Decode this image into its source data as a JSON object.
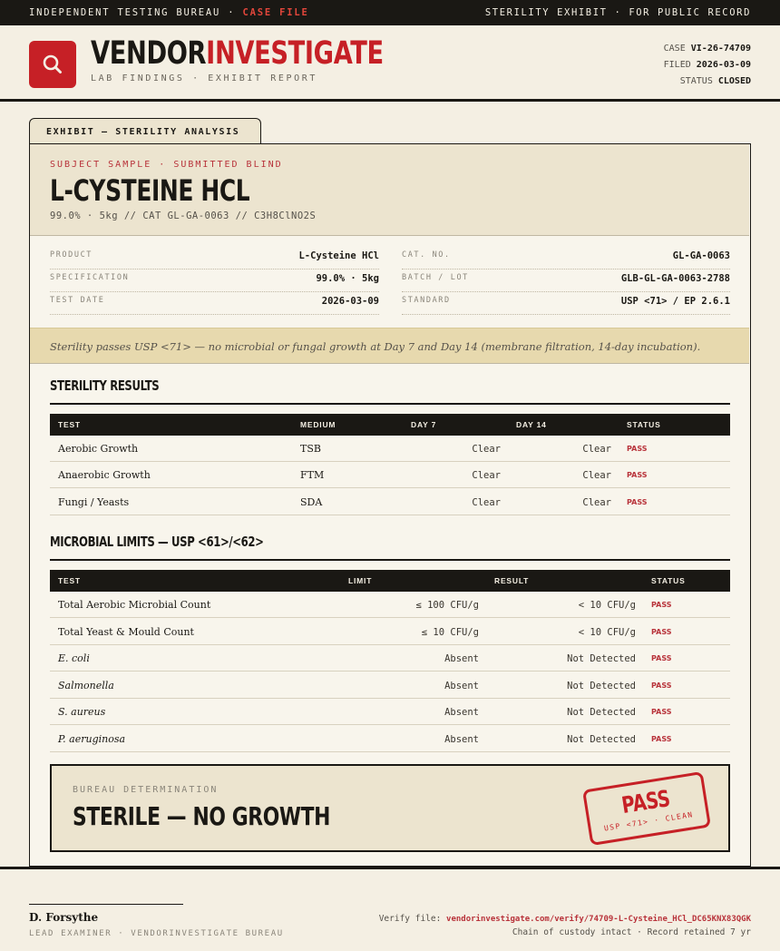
{
  "topbar": {
    "left_prefix": "INDEPENDENT TESTING BUREAU · ",
    "left_highlight": "CASE FILE",
    "right": "STERILITY EXHIBIT · FOR PUBLIC RECORD"
  },
  "header": {
    "logo_icon": "magnifier-icon",
    "brand_part1": "VENDOR",
    "brand_part2": "INVESTIGATE",
    "subtitle": "LAB FINDINGS · EXHIBIT REPORT",
    "case_label": "CASE",
    "case_value": "VI-26-74709",
    "filed_label": "FILED",
    "filed_value": "2026-03-09",
    "status_label": "STATUS",
    "status_value": "CLOSED"
  },
  "tab": {
    "label": "EXHIBIT — STERILITY ANALYSIS"
  },
  "subject": {
    "kicker": "SUBJECT SAMPLE · SUBMITTED BLIND",
    "title": "L-CYSTEINE HCL",
    "details": "99.0% · 5kg  //  CAT GL-GA-0063  //  C3H8ClNO2S"
  },
  "info": {
    "left": [
      {
        "label": "PRODUCT",
        "value": "L-Cysteine HCl"
      },
      {
        "label": "SPECIFICATION",
        "value": "99.0% · 5kg"
      },
      {
        "label": "TEST DATE",
        "value": "2026-03-09"
      }
    ],
    "right": [
      {
        "label": "CAT. NO.",
        "value": "GL-GA-0063"
      },
      {
        "label": "BATCH / LOT",
        "value": "GLB-GL-GA-0063-2788"
      },
      {
        "label": "STANDARD",
        "value": "USP <71> / EP 2.6.1"
      }
    ]
  },
  "summary_note": "Sterility passes USP <71> — no microbial or fungal growth at Day 7 and Day 14 (membrane filtration, 14-day incubation).",
  "sterility": {
    "title": "STERILITY RESULTS",
    "headers": [
      "TEST",
      "MEDIUM",
      "DAY 7",
      "DAY 14",
      "STATUS"
    ],
    "rows": [
      {
        "test": "Aerobic Growth",
        "medium": "TSB",
        "day7": "Clear",
        "day14": "Clear",
        "status": "PASS"
      },
      {
        "test": "Anaerobic Growth",
        "medium": "FTM",
        "day7": "Clear",
        "day14": "Clear",
        "status": "PASS"
      },
      {
        "test": "Fungi / Yeasts",
        "medium": "SDA",
        "day7": "Clear",
        "day14": "Clear",
        "status": "PASS"
      }
    ]
  },
  "microbial": {
    "title": "MICROBIAL LIMITS — USP <61>/<62>",
    "headers": [
      "TEST",
      "LIMIT",
      "RESULT",
      "STATUS"
    ],
    "rows": [
      {
        "test": "Total Aerobic Microbial Count",
        "limit": "≤ 100 CFU/g",
        "result": "< 10 CFU/g",
        "status": "PASS"
      },
      {
        "test": "Total Yeast & Mould Count",
        "limit": "≤ 10 CFU/g",
        "result": "< 10 CFU/g",
        "status": "PASS"
      },
      {
        "test": "E. coli",
        "limit": "Absent",
        "result": "Not Detected",
        "status": "PASS"
      },
      {
        "test": "Salmonella",
        "limit": "Absent",
        "result": "Not Detected",
        "status": "PASS"
      },
      {
        "test": "S. aureus",
        "limit": "Absent",
        "result": "Not Detected",
        "status": "PASS"
      },
      {
        "test": "P. aeruginosa",
        "limit": "Absent",
        "result": "Not Detected",
        "status": "PASS"
      }
    ]
  },
  "verdict": {
    "kicker": "BUREAU DETERMINATION",
    "title": "STERILE — NO GROWTH",
    "stamp_main": "PASS",
    "stamp_sub": "USP <71> · CLEAN"
  },
  "footer": {
    "signer": "D. Forsythe",
    "signer_role": "LEAD EXAMINER · VENDORINVESTIGATE BUREAU",
    "verify_label": "Verify file: ",
    "verify_url": "vendorinvestigate.com/verify/74709-L-Cysteine_HCl_DC65KNX83QGK",
    "custody": "Chain of custody intact · Record retained 7 yr"
  },
  "colors": {
    "accent_red": "#c62026",
    "ink": "#1a1814",
    "paper": "#f4efe3",
    "note_tan": "#e7d9ae"
  }
}
